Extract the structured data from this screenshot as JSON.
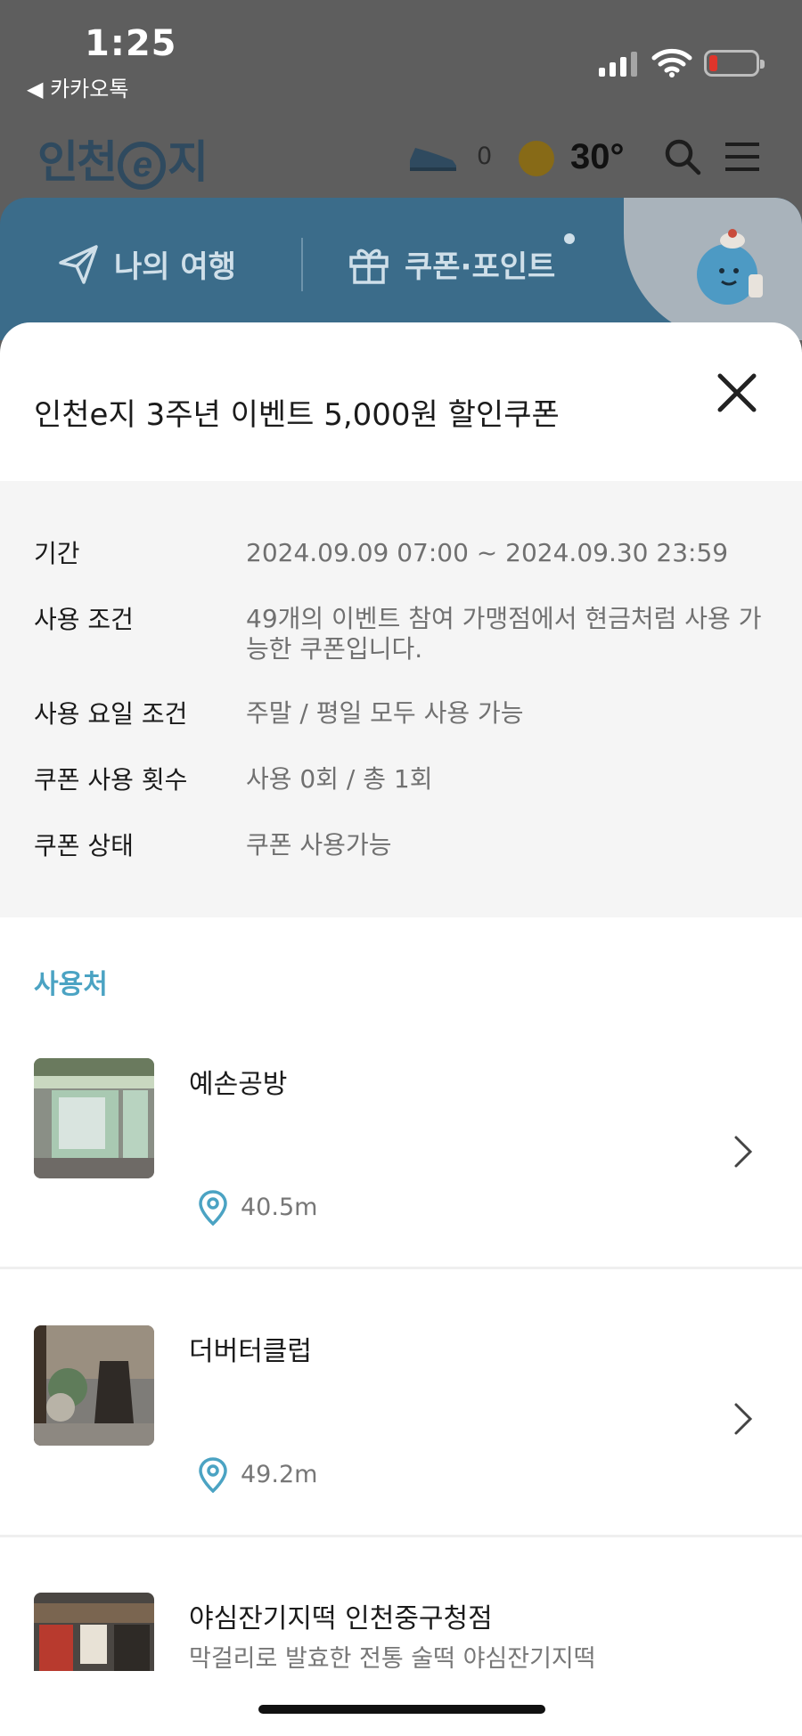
{
  "status_bar": {
    "time": "1:25",
    "back_app": "◀ 카카오톡"
  },
  "header": {
    "logo_prefix": "인천",
    "logo_e": "e",
    "logo_suffix": "지",
    "step_count": "0",
    "temperature": "30°"
  },
  "banner": {
    "my_trip_label": "나의 여행",
    "coupon_point_label": "쿠폰·포인트"
  },
  "coupon": {
    "title": "인천e지 3주년 이벤트 5,000원 할인쿠폰",
    "details": [
      {
        "label": "기간",
        "value": "2024.09.09 07:00 ~ 2024.09.30 23:59"
      },
      {
        "label": "사용 조건",
        "value": "49개의 이벤트 참여 가맹점에서 현금처럼 사용 가능한 쿠폰입니다."
      },
      {
        "label": "사용 요일 조건",
        "value": "주말 / 평일 모두 사용 가능"
      },
      {
        "label": "쿠폰 사용 횟수",
        "value": "사용 0회 / 총 1회"
      },
      {
        "label": "쿠폰 상태",
        "value": "쿠폰 사용가능"
      }
    ]
  },
  "stores_section": {
    "title": "사용처",
    "stores": [
      {
        "name": "예손공방",
        "desc": "",
        "distance": "40.5m"
      },
      {
        "name": "더버터클럽",
        "desc": "",
        "distance": "49.2m"
      },
      {
        "name": "야심잔기지떡 인천중구청점",
        "desc": "막걸리로 발효한 전통 술떡 야심잔기지떡",
        "distance": ""
      }
    ]
  },
  "colors": {
    "accent": "#4ba3c3",
    "banner": "#3b6c8a",
    "battery_low": "#e0352b"
  }
}
